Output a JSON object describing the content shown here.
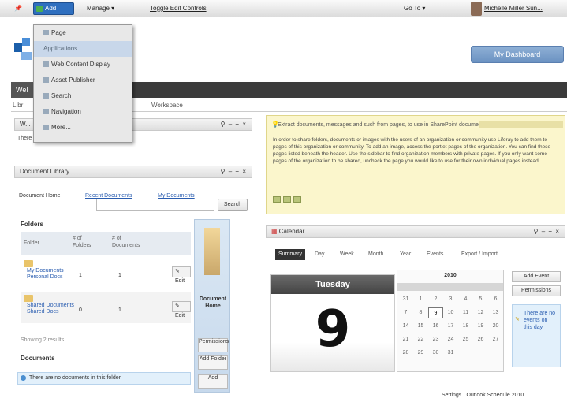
{
  "dockbar": {
    "add_label": "Add",
    "manage_label": "Manage ▾",
    "toggle_label": "Toggle Edit Controls",
    "goto_label": "Go To ▾",
    "user_label": "Michelle Miller Sun..."
  },
  "add_menu": {
    "items": [
      "Page",
      "Applications",
      "Web Content Display",
      "Asset Publisher",
      "Search",
      "Navigation",
      "More..."
    ]
  },
  "header": {
    "go_button": "My Dashboard"
  },
  "nav": {
    "tab": "Wel",
    "crumb_left": "Libr",
    "crumb_right": "Workspace"
  },
  "welcome_portlet": {
    "title": "W...",
    "text": "There are no recent documents."
  },
  "doclib": {
    "title": "Document Library",
    "tabs": [
      "Document Home",
      "Recent Documents",
      "My Documents"
    ],
    "search_button": "Search",
    "folders_title": "Folders",
    "columns": [
      "Folder",
      "# of Folders",
      "# of Documents"
    ],
    "rows": [
      {
        "name": "My Documents Personal Docs",
        "folders": "1",
        "docs": "1",
        "action": "Edit"
      },
      {
        "name": "Shared Documents Shared Docs",
        "folders": "0",
        "docs": "1",
        "action": "Edit"
      }
    ],
    "showing": "Showing 2 results.",
    "documents_title": "Documents",
    "documents_info": "There are no documents in this folder.",
    "side_label": "Document Home",
    "side_btn1": "Permissions",
    "side_btn2": "Add Folder",
    "side_btn3": "Add"
  },
  "alert": {
    "heading": "Extract documents, messages and such from pages, to use in SharePoint documents",
    "body": "In order to share folders, documents or images with the users of an organization or community use Liferay to add them to pages of this organization or community. To add an image, access the portlet pages of the organization. You can find these pages listed beneath the header. Use the sidebar to find organization members with private pages. If you only want some pages of the organization to be shared, uncheck the page you would like to use for their own individual pages instead."
  },
  "calendar": {
    "title": "Calendar",
    "tabs": [
      "Summary",
      "Day",
      "Week",
      "Month",
      "Year",
      "Events",
      "Export / Import"
    ],
    "day_name": "Tuesday",
    "day_number": "9",
    "month_label": "2010",
    "weeks": [
      [
        "31",
        "1",
        "2",
        "3",
        "4",
        "5",
        "6"
      ],
      [
        "7",
        "8",
        "9",
        "10",
        "11",
        "12",
        "13"
      ],
      [
        "14",
        "15",
        "16",
        "17",
        "18",
        "19",
        "20"
      ],
      [
        "21",
        "22",
        "23",
        "24",
        "25",
        "26",
        "27"
      ],
      [
        "28",
        "29",
        "30",
        "31",
        "",
        "",
        ""
      ]
    ],
    "today_index": [
      1,
      2
    ],
    "add_event": "Add Event",
    "permissions": "Permissions",
    "note": "There are no events on this day."
  },
  "footer": "Settings · Outlook Schedule 2010"
}
